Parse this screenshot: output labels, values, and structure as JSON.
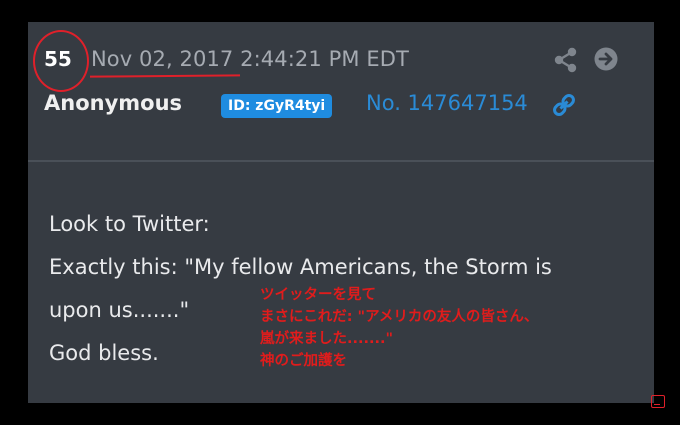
{
  "post": {
    "number": "55",
    "date": "Nov 02, 2017 2:44:21 PM EDT",
    "author": "Anonymous",
    "id_badge": "ID: zGyR4tyi",
    "post_link": "No. 147647154",
    "body_lines": [
      "Look to Twitter:",
      "Exactly this: \"My fellow Americans, the Storm is",
      "upon us.......\"",
      "God bless."
    ]
  },
  "annotation": {
    "lines": [
      "ツイッターを見て",
      "まさにこれだ: \"アメリカの友人の皆さん、",
      "嵐が来ました.......\"",
      "神のご加護を"
    ]
  },
  "icons": {
    "share": "share-icon",
    "arrow": "arrow-right-circle-icon",
    "link": "link-icon",
    "corner": "screen-icon"
  },
  "colors": {
    "background": "#000000",
    "card": "#363b42",
    "accent_blue": "#1f8ce0",
    "link_blue": "#2a8bd6",
    "annotation_red": "#e01c1c",
    "muted_text": "#a6abb2"
  }
}
